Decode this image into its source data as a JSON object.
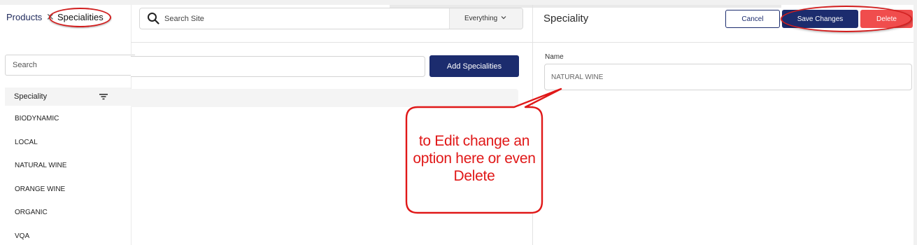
{
  "breadcrumb": {
    "parent": "Products",
    "separator": "✕",
    "current": "Specialities"
  },
  "sidebar": {
    "search_placeholder": "Search",
    "column_header": "Speciality",
    "filter_icon": "filter-icon",
    "items": [
      {
        "label": "BIODYNAMIC"
      },
      {
        "label": "LOCAL"
      },
      {
        "label": "NATURAL WINE"
      },
      {
        "label": "ORANGE WINE"
      },
      {
        "label": "ORGANIC"
      },
      {
        "label": "VQA"
      }
    ]
  },
  "header": {
    "search_placeholder": "Search Site",
    "search_icon": "search-icon",
    "scope": "Everything",
    "scope_icon": "chevron-down-icon"
  },
  "main": {
    "add_button_label": "Add Specialities"
  },
  "detail": {
    "title": "Speciality",
    "cancel_label": "Cancel",
    "save_label": "Save Changes",
    "delete_label": "Delete",
    "name_label": "Name",
    "name_value": "NATURAL WINE"
  },
  "annotation": {
    "callout_text": "to Edit change an option here or even Delete",
    "color": "#e01818"
  },
  "colors": {
    "primary": "#1c2c6e",
    "danger": "#f04d4d",
    "annotation": "#d21e1e"
  }
}
